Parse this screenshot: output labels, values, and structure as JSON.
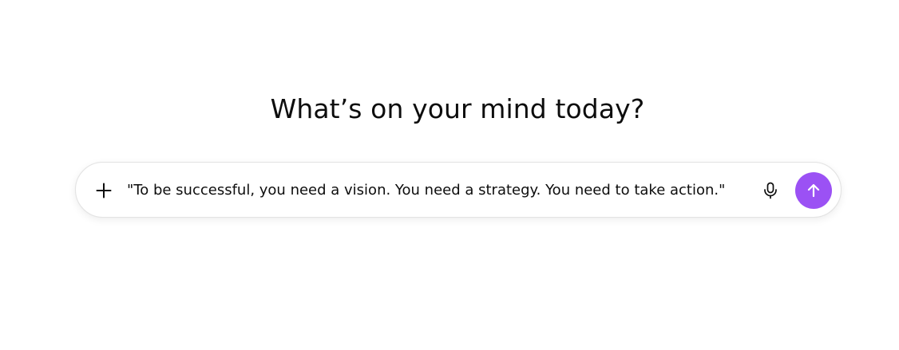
{
  "headline": "What’s on your mind today?",
  "composer": {
    "prompt_value": "\"To be successful, you need a vision. You need a strategy. You need to take action.\"",
    "plus_icon": "plus-icon",
    "mic_icon": "microphone-icon",
    "send_icon": "arrow-up-icon"
  },
  "colors": {
    "send_button": "#9b51f4",
    "text": "#0d0d0d",
    "composer_border": "#e3e3e3"
  }
}
